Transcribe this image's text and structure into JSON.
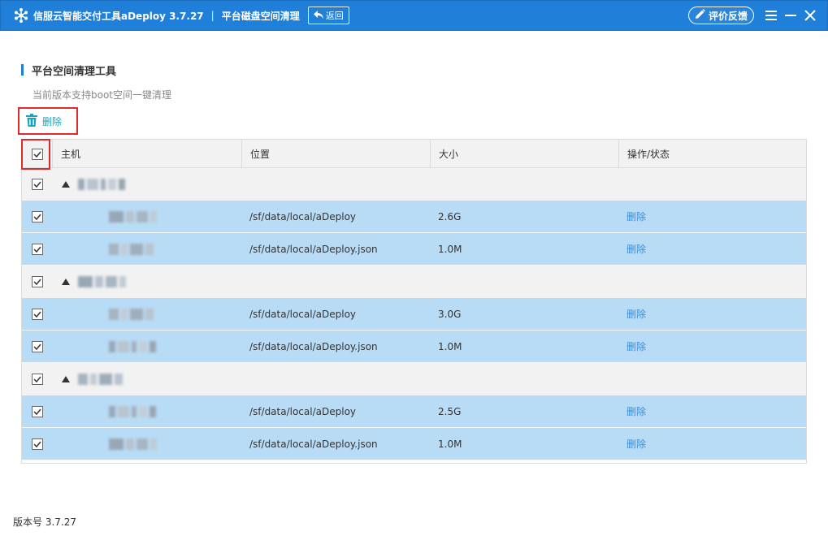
{
  "window": {
    "app_title": "信服云智能交付工具aDeploy 3.7.27",
    "separator": "|",
    "page_name": "平台磁盘空间清理",
    "back_label": "返回",
    "feedback_label": "评价反馈"
  },
  "section": {
    "title": "平台空间清理工具",
    "desc": "当前版本支持boot空间一键清理"
  },
  "toolbar": {
    "delete_label": "删除"
  },
  "table": {
    "columns": [
      "",
      "主机",
      "位置",
      "大小",
      "操作/状态"
    ],
    "groups": [
      {
        "host": "",
        "items": [
          {
            "host": "",
            "path": "/sf/data/local/aDeploy",
            "size": "2.6G",
            "action": "删除"
          },
          {
            "host": "",
            "path": "/sf/data/local/aDeploy.json",
            "size": "1.0M",
            "action": "删除"
          }
        ]
      },
      {
        "host": "",
        "items": [
          {
            "host": "",
            "path": "/sf/data/local/aDeploy",
            "size": "3.0G",
            "action": "删除"
          },
          {
            "host": "",
            "path": "/sf/data/local/aDeploy.json",
            "size": "1.0M",
            "action": "删除"
          }
        ]
      },
      {
        "host": "",
        "items": [
          {
            "host": "",
            "path": "/sf/data/local/aDeploy",
            "size": "2.5G",
            "action": "删除"
          },
          {
            "host": "",
            "path": "/sf/data/local/aDeploy.json",
            "size": "1.0M",
            "action": "删除"
          }
        ]
      }
    ]
  },
  "footer": {
    "version": "版本号 3.7.27"
  },
  "colors": {
    "titlebar": "#1f7fd9",
    "row_selected": "#b8dcf5",
    "group_row": "#f2f2f2",
    "link": "#3a8ee0",
    "delete_teal": "#18a6b9",
    "highlight_frame": "#e02b2b"
  },
  "icons": {
    "logo": "snowflake-logo-icon",
    "back": "back-arrow-icon",
    "feedback": "pencil-icon",
    "menu": "menu-icon",
    "minimize": "minimize-icon",
    "close": "close-icon",
    "delete": "trash-icon",
    "check": "check-icon",
    "expand": "caret-icon"
  }
}
